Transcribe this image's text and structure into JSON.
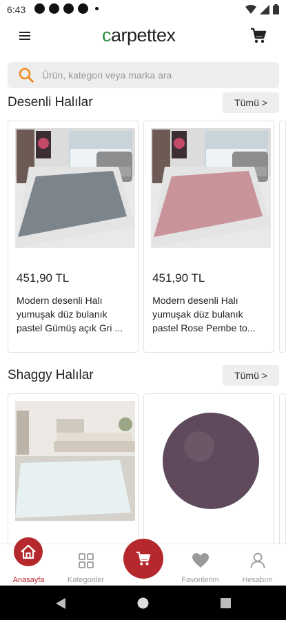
{
  "status_bar": {
    "time": "6:43"
  },
  "header": {
    "logo": "carpettex"
  },
  "search": {
    "placeholder": "Ürün, kategori veya marka ara"
  },
  "sections": [
    {
      "title": "Desenli Halılar",
      "see_all": "Tümü >",
      "products": [
        {
          "price": "451,90 TL",
          "name": "Modern desenli Halı yumuşak düz bulanık pastel Gümüş açık Gri ...",
          "rug_color": "#7d858c"
        },
        {
          "price": "451,90 TL",
          "name": "Modern desenli Halı yumuşak düz bulanık pastel Rose Pembe to...",
          "rug_color": "#c9939a"
        }
      ]
    },
    {
      "title": "Shaggy Halılar",
      "see_all": "Tümü >",
      "products": [
        {
          "price": "",
          "rug_color": "#e8f1f2"
        },
        {
          "price": "",
          "rug_color": "#5e4a5c"
        }
      ]
    }
  ],
  "bottom_nav": {
    "home": "Anasayfa",
    "categories": "Kategoriler",
    "favorites": "Favorilerim",
    "account": "Hesabım"
  },
  "colors": {
    "accent": "#b5282c",
    "logo_c": "#2a8a3a"
  }
}
